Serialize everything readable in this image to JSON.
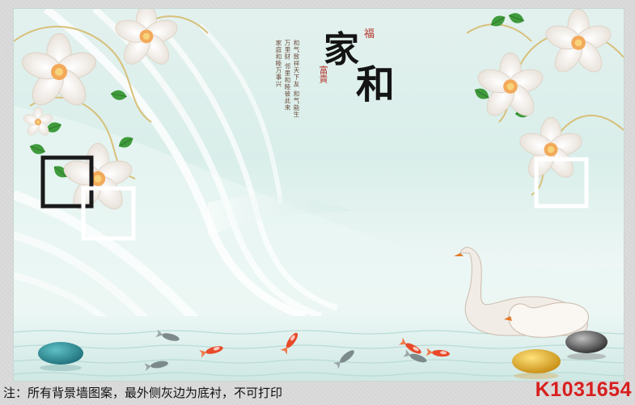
{
  "image": {
    "footer_note": "注：所有背景墙图案，最外侧灰边为底衬，不可打印",
    "product_code": "K1031654"
  },
  "calligraphy": {
    "char_1": "家",
    "char_2": "和",
    "seal_top": "福",
    "seal_side": "富貴",
    "poem": "和气致祥天下友 和气能生万里财 邻里和睦彼此来 家庭和睦万事兴"
  },
  "colors": {
    "background_teal": "#d9eeea",
    "footer_text": "#111111",
    "product_code": "#d81f1f",
    "seal_red": "#b3342b"
  }
}
